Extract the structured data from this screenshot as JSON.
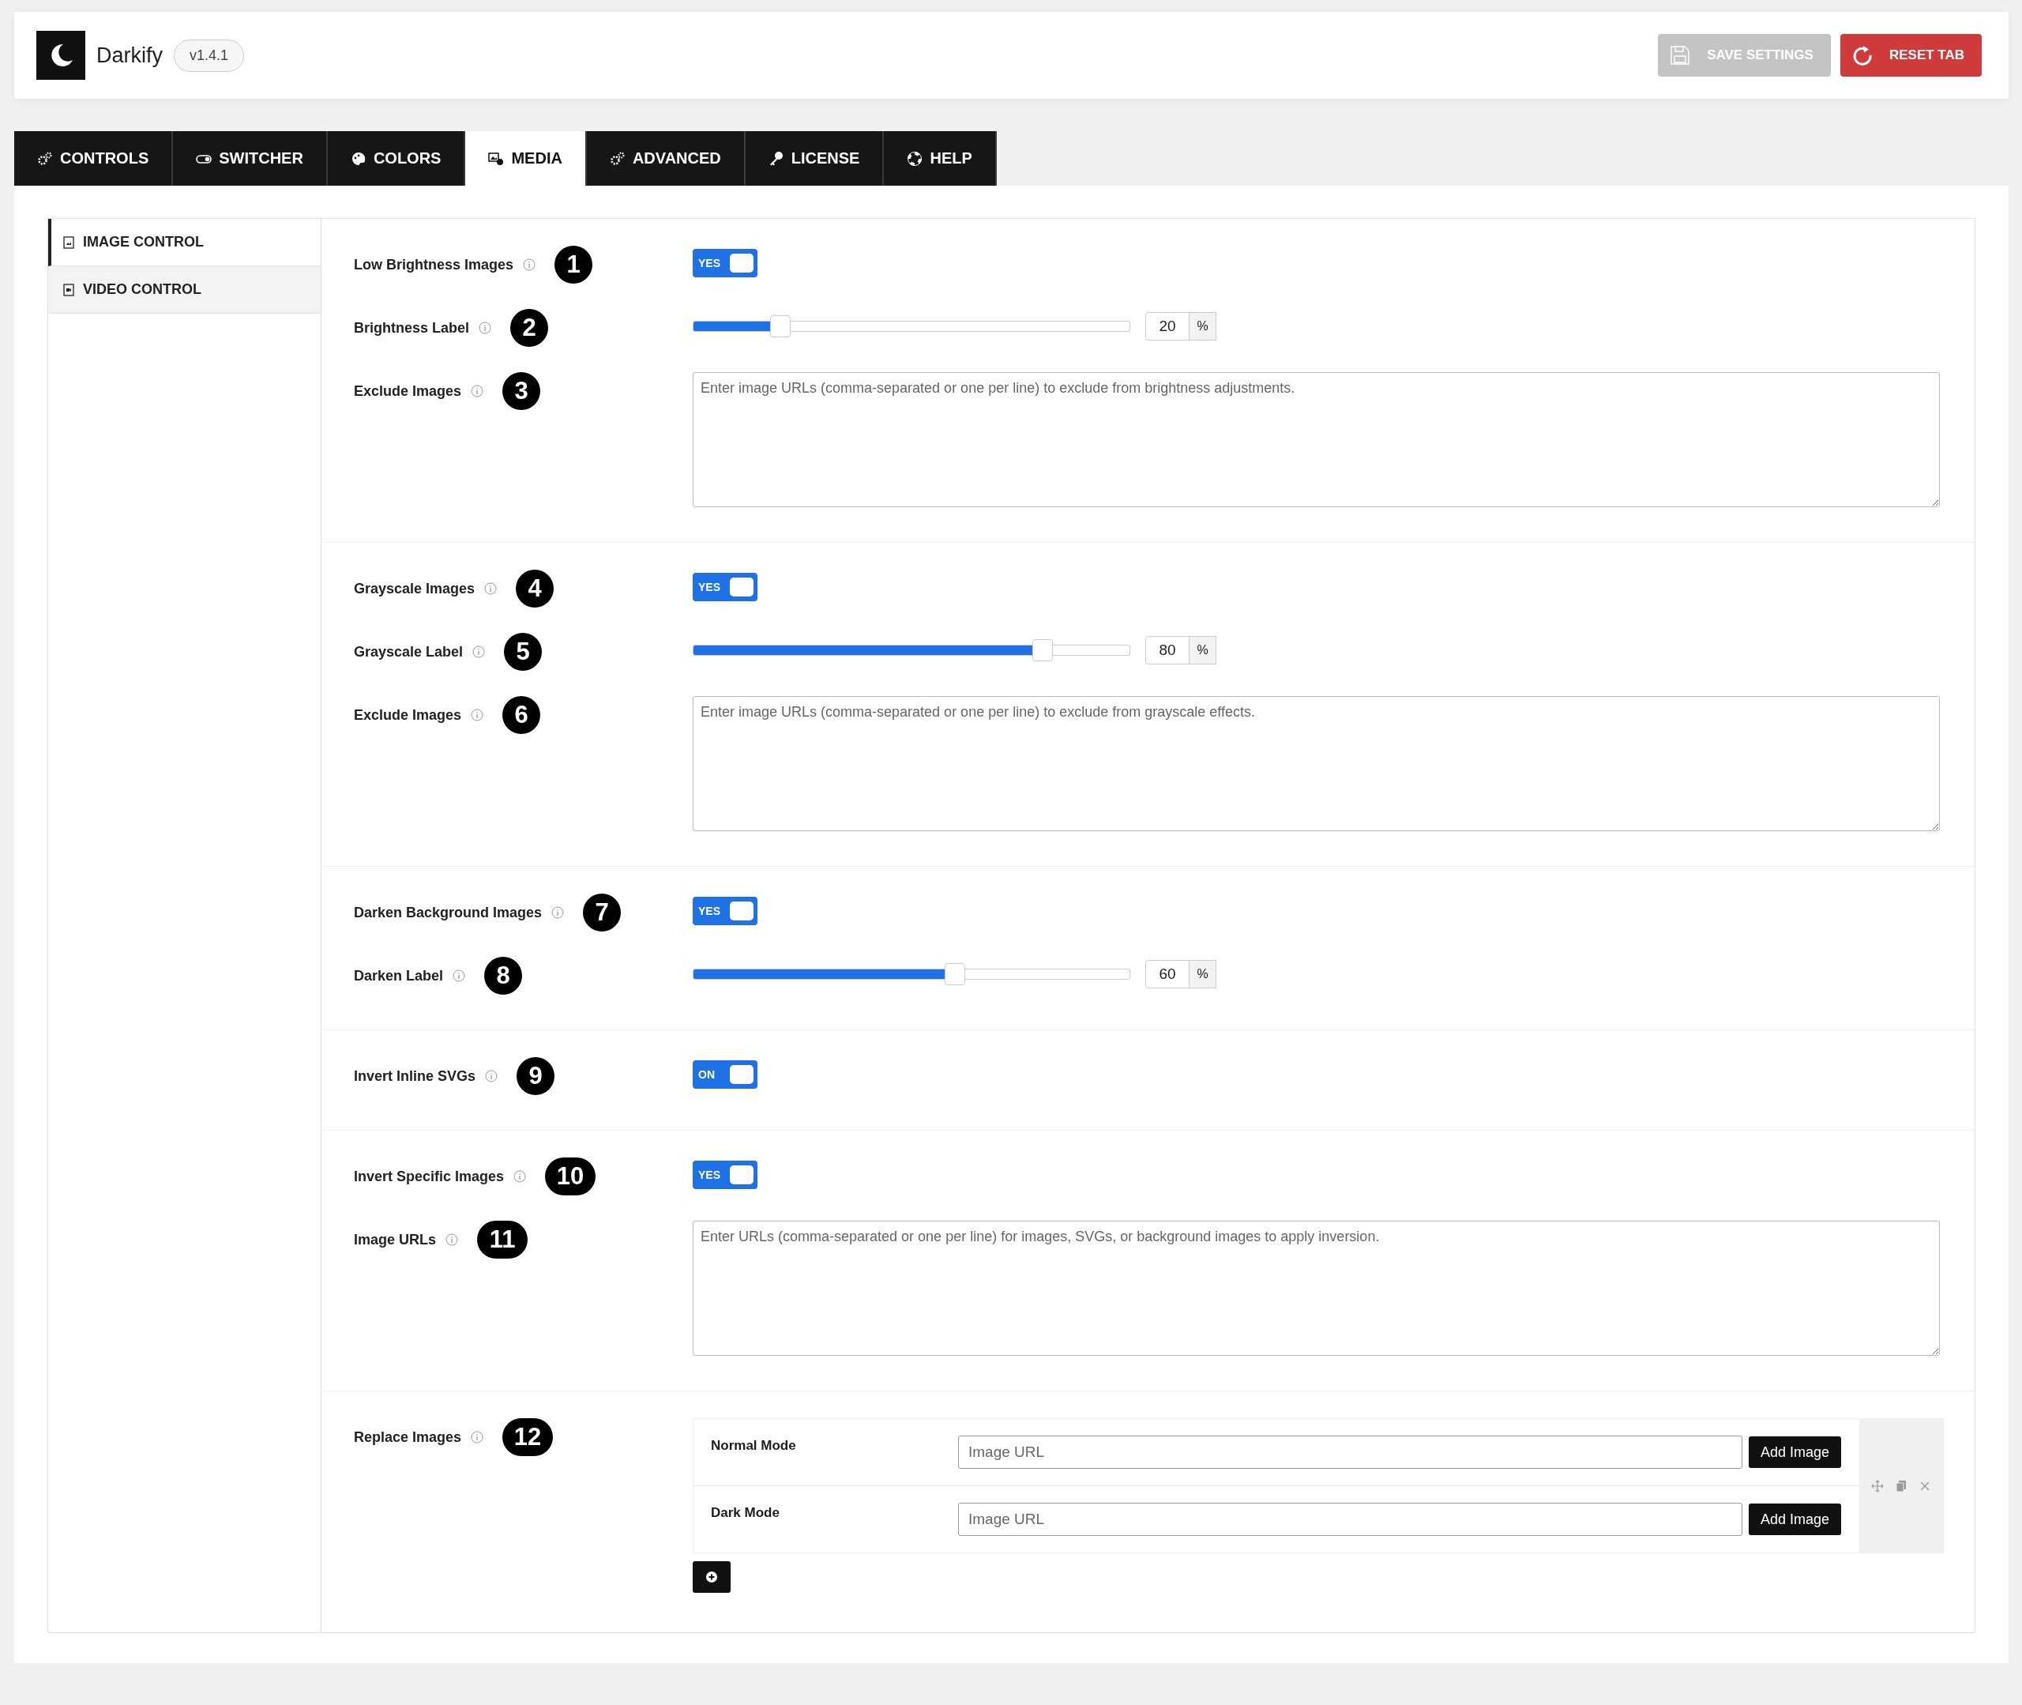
{
  "app": {
    "name": "Darkify",
    "version": "v1.4.1"
  },
  "header_buttons": [
    {
      "label": "SAVE SETTINGS",
      "kind": "save",
      "disabled": true
    },
    {
      "label": "RESET TAB",
      "kind": "reset",
      "disabled": false
    }
  ],
  "tabs": [
    {
      "label": "CONTROLS",
      "kind": "gears",
      "selected": false
    },
    {
      "label": "SWITCHER",
      "kind": "switch",
      "selected": false
    },
    {
      "label": "COLORS",
      "kind": "palette",
      "selected": false
    },
    {
      "label": "MEDIA",
      "kind": "media",
      "selected": true
    },
    {
      "label": "ADVANCED",
      "kind": "gears",
      "selected": false
    },
    {
      "label": "LICENSE",
      "kind": "key",
      "selected": false
    },
    {
      "label": "HELP",
      "kind": "help",
      "selected": false
    }
  ],
  "sidebar": {
    "items": [
      {
        "label": "IMAGE CONTROL",
        "kind": "image",
        "selected": true
      },
      {
        "label": "VIDEO CONTROL",
        "kind": "video",
        "selected": false
      }
    ]
  },
  "sections": [
    {
      "fields": [
        {
          "kind": "toggle",
          "label": "Low Brightness Images",
          "badge": "1",
          "on": true,
          "toggle_text": "YES"
        },
        {
          "kind": "slider",
          "label": "Brightness Label",
          "badge": "2",
          "level": 0.2,
          "value": "20",
          "unit": "%"
        },
        {
          "kind": "textarea",
          "label": "Exclude Images",
          "badge": "3",
          "placeholder": "Enter image URLs (comma-separated or one per line) to exclude from brightness adjustments."
        }
      ]
    },
    {
      "fields": [
        {
          "kind": "toggle",
          "label": "Grayscale Images",
          "badge": "4",
          "on": true,
          "toggle_text": "YES"
        },
        {
          "kind": "slider",
          "label": "Grayscale Label",
          "badge": "5",
          "level": 0.8,
          "value": "80",
          "unit": "%"
        },
        {
          "kind": "textarea",
          "label": "Exclude Images",
          "badge": "6",
          "placeholder": "Enter image URLs (comma-separated or one per line) to exclude from grayscale effects."
        }
      ]
    },
    {
      "fields": [
        {
          "kind": "toggle",
          "label": "Darken Background Images",
          "badge": "7",
          "on": true,
          "toggle_text": "YES"
        },
        {
          "kind": "slider",
          "label": "Darken Label",
          "badge": "8",
          "level": 0.6,
          "value": "60",
          "unit": "%"
        }
      ]
    },
    {
      "fields": [
        {
          "kind": "toggle",
          "label": "Invert Inline SVGs",
          "badge": "9",
          "on": true,
          "toggle_text": "ON"
        }
      ]
    },
    {
      "fields": [
        {
          "kind": "toggle",
          "label": "Invert Specific Images",
          "badge": "10",
          "on": true,
          "toggle_text": "YES"
        },
        {
          "kind": "textarea",
          "label": "Image URLs",
          "badge": "11",
          "placeholder": "Enter URLs (comma-separated or one per line) for images, SVGs, or background images to apply inversion."
        }
      ]
    },
    {
      "fields": [
        {
          "kind": "repeater",
          "label": "Replace Images",
          "badge": "12",
          "rows": [
            {
              "label": "Normal Mode",
              "placeholder": "Image URL",
              "button": "Add Image"
            },
            {
              "label": "Dark Mode",
              "placeholder": "Image URL",
              "button": "Add Image"
            }
          ]
        }
      ]
    }
  ]
}
